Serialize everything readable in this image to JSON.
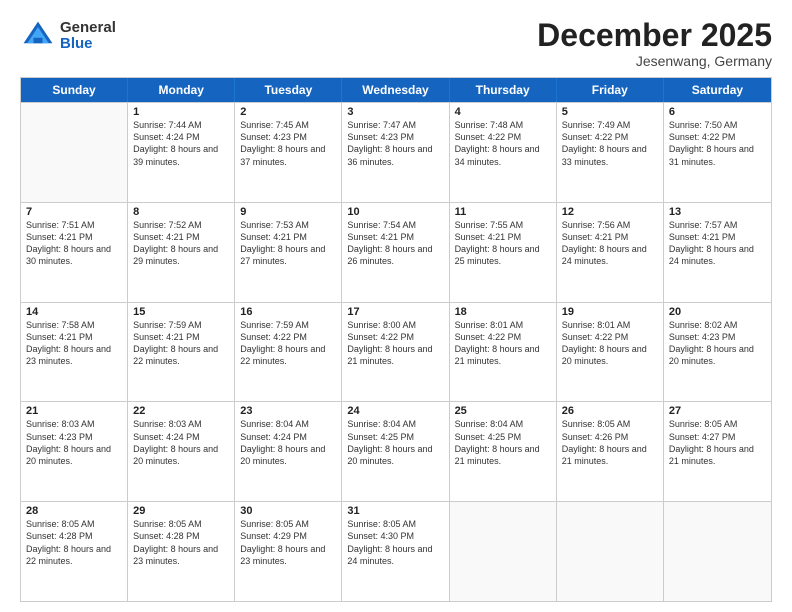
{
  "header": {
    "logo": {
      "line1": "General",
      "line2": "Blue"
    },
    "title": "December 2025",
    "subtitle": "Jesenwang, Germany"
  },
  "days_of_week": [
    "Sunday",
    "Monday",
    "Tuesday",
    "Wednesday",
    "Thursday",
    "Friday",
    "Saturday"
  ],
  "weeks": [
    [
      {
        "day": "",
        "empty": true
      },
      {
        "day": "1",
        "sunrise": "Sunrise: 7:44 AM",
        "sunset": "Sunset: 4:24 PM",
        "daylight": "Daylight: 8 hours and 39 minutes."
      },
      {
        "day": "2",
        "sunrise": "Sunrise: 7:45 AM",
        "sunset": "Sunset: 4:23 PM",
        "daylight": "Daylight: 8 hours and 37 minutes."
      },
      {
        "day": "3",
        "sunrise": "Sunrise: 7:47 AM",
        "sunset": "Sunset: 4:23 PM",
        "daylight": "Daylight: 8 hours and 36 minutes."
      },
      {
        "day": "4",
        "sunrise": "Sunrise: 7:48 AM",
        "sunset": "Sunset: 4:22 PM",
        "daylight": "Daylight: 8 hours and 34 minutes."
      },
      {
        "day": "5",
        "sunrise": "Sunrise: 7:49 AM",
        "sunset": "Sunset: 4:22 PM",
        "daylight": "Daylight: 8 hours and 33 minutes."
      },
      {
        "day": "6",
        "sunrise": "Sunrise: 7:50 AM",
        "sunset": "Sunset: 4:22 PM",
        "daylight": "Daylight: 8 hours and 31 minutes."
      }
    ],
    [
      {
        "day": "7",
        "sunrise": "Sunrise: 7:51 AM",
        "sunset": "Sunset: 4:21 PM",
        "daylight": "Daylight: 8 hours and 30 minutes."
      },
      {
        "day": "8",
        "sunrise": "Sunrise: 7:52 AM",
        "sunset": "Sunset: 4:21 PM",
        "daylight": "Daylight: 8 hours and 29 minutes."
      },
      {
        "day": "9",
        "sunrise": "Sunrise: 7:53 AM",
        "sunset": "Sunset: 4:21 PM",
        "daylight": "Daylight: 8 hours and 27 minutes."
      },
      {
        "day": "10",
        "sunrise": "Sunrise: 7:54 AM",
        "sunset": "Sunset: 4:21 PM",
        "daylight": "Daylight: 8 hours and 26 minutes."
      },
      {
        "day": "11",
        "sunrise": "Sunrise: 7:55 AM",
        "sunset": "Sunset: 4:21 PM",
        "daylight": "Daylight: 8 hours and 25 minutes."
      },
      {
        "day": "12",
        "sunrise": "Sunrise: 7:56 AM",
        "sunset": "Sunset: 4:21 PM",
        "daylight": "Daylight: 8 hours and 24 minutes."
      },
      {
        "day": "13",
        "sunrise": "Sunrise: 7:57 AM",
        "sunset": "Sunset: 4:21 PM",
        "daylight": "Daylight: 8 hours and 24 minutes."
      }
    ],
    [
      {
        "day": "14",
        "sunrise": "Sunrise: 7:58 AM",
        "sunset": "Sunset: 4:21 PM",
        "daylight": "Daylight: 8 hours and 23 minutes."
      },
      {
        "day": "15",
        "sunrise": "Sunrise: 7:59 AM",
        "sunset": "Sunset: 4:21 PM",
        "daylight": "Daylight: 8 hours and 22 minutes."
      },
      {
        "day": "16",
        "sunrise": "Sunrise: 7:59 AM",
        "sunset": "Sunset: 4:22 PM",
        "daylight": "Daylight: 8 hours and 22 minutes."
      },
      {
        "day": "17",
        "sunrise": "Sunrise: 8:00 AM",
        "sunset": "Sunset: 4:22 PM",
        "daylight": "Daylight: 8 hours and 21 minutes."
      },
      {
        "day": "18",
        "sunrise": "Sunrise: 8:01 AM",
        "sunset": "Sunset: 4:22 PM",
        "daylight": "Daylight: 8 hours and 21 minutes."
      },
      {
        "day": "19",
        "sunrise": "Sunrise: 8:01 AM",
        "sunset": "Sunset: 4:22 PM",
        "daylight": "Daylight: 8 hours and 20 minutes."
      },
      {
        "day": "20",
        "sunrise": "Sunrise: 8:02 AM",
        "sunset": "Sunset: 4:23 PM",
        "daylight": "Daylight: 8 hours and 20 minutes."
      }
    ],
    [
      {
        "day": "21",
        "sunrise": "Sunrise: 8:03 AM",
        "sunset": "Sunset: 4:23 PM",
        "daylight": "Daylight: 8 hours and 20 minutes."
      },
      {
        "day": "22",
        "sunrise": "Sunrise: 8:03 AM",
        "sunset": "Sunset: 4:24 PM",
        "daylight": "Daylight: 8 hours and 20 minutes."
      },
      {
        "day": "23",
        "sunrise": "Sunrise: 8:04 AM",
        "sunset": "Sunset: 4:24 PM",
        "daylight": "Daylight: 8 hours and 20 minutes."
      },
      {
        "day": "24",
        "sunrise": "Sunrise: 8:04 AM",
        "sunset": "Sunset: 4:25 PM",
        "daylight": "Daylight: 8 hours and 20 minutes."
      },
      {
        "day": "25",
        "sunrise": "Sunrise: 8:04 AM",
        "sunset": "Sunset: 4:25 PM",
        "daylight": "Daylight: 8 hours and 21 minutes."
      },
      {
        "day": "26",
        "sunrise": "Sunrise: 8:05 AM",
        "sunset": "Sunset: 4:26 PM",
        "daylight": "Daylight: 8 hours and 21 minutes."
      },
      {
        "day": "27",
        "sunrise": "Sunrise: 8:05 AM",
        "sunset": "Sunset: 4:27 PM",
        "daylight": "Daylight: 8 hours and 21 minutes."
      }
    ],
    [
      {
        "day": "28",
        "sunrise": "Sunrise: 8:05 AM",
        "sunset": "Sunset: 4:28 PM",
        "daylight": "Daylight: 8 hours and 22 minutes."
      },
      {
        "day": "29",
        "sunrise": "Sunrise: 8:05 AM",
        "sunset": "Sunset: 4:28 PM",
        "daylight": "Daylight: 8 hours and 23 minutes."
      },
      {
        "day": "30",
        "sunrise": "Sunrise: 8:05 AM",
        "sunset": "Sunset: 4:29 PM",
        "daylight": "Daylight: 8 hours and 23 minutes."
      },
      {
        "day": "31",
        "sunrise": "Sunrise: 8:05 AM",
        "sunset": "Sunset: 4:30 PM",
        "daylight": "Daylight: 8 hours and 24 minutes."
      },
      {
        "day": "",
        "empty": true
      },
      {
        "day": "",
        "empty": true
      },
      {
        "day": "",
        "empty": true
      }
    ]
  ]
}
